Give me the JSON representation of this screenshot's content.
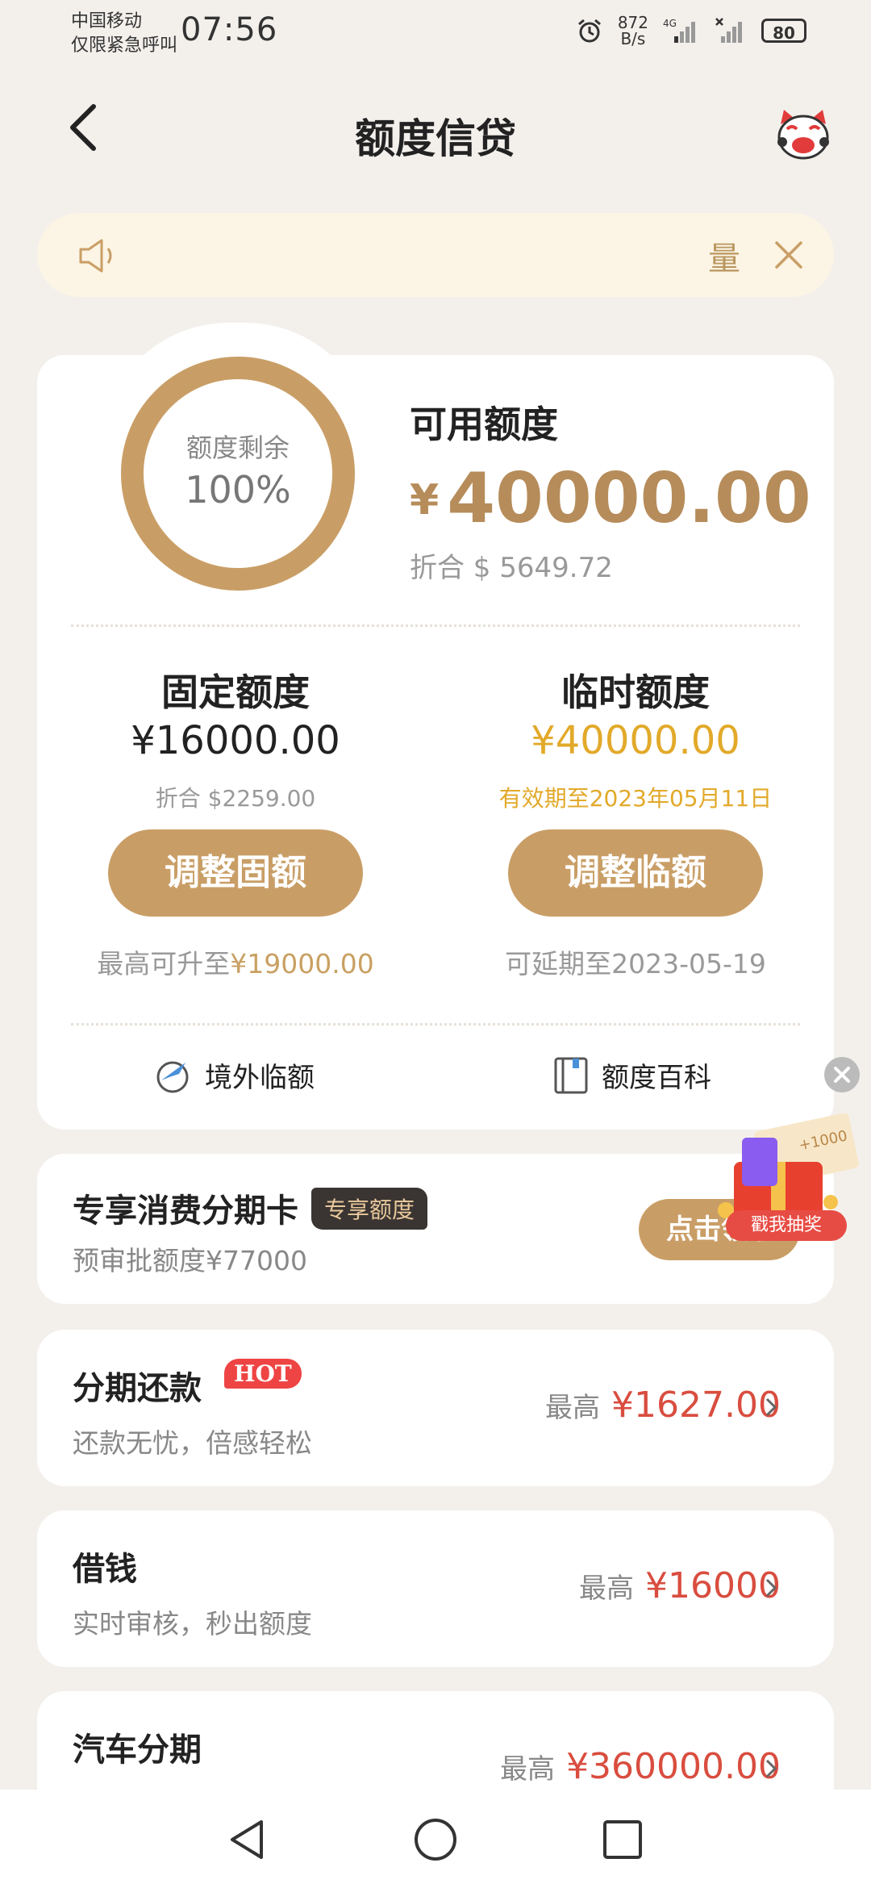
{
  "status_bar": {
    "carrier_line1": "中国移动",
    "carrier_line2": "仅限紧急呼叫",
    "time": "07:56",
    "net_speed_value": "872",
    "net_speed_unit": "B/s",
    "network": "4G",
    "battery": "80"
  },
  "header": {
    "title": "额度信贷"
  },
  "notice": {
    "text": "量"
  },
  "quota": {
    "ring_label": "额度剩余",
    "ring_percent": "100%",
    "ring_fraction": 1.0,
    "available_title": "可用额度",
    "currency_symbol": "¥",
    "available_amount": "40000.00",
    "available_usd": "折合 $ 5649.72"
  },
  "fixed": {
    "title": "固定额度",
    "amount": "¥16000.00",
    "usd": "折合 $2259.00",
    "button": "调整固额",
    "note_prefix": "最高可升至",
    "note_value": "¥19000.00"
  },
  "temp": {
    "title": "临时额度",
    "amount": "¥40000.00",
    "validity": "有效期至2023年05月11日",
    "button": "调整临额",
    "note": "可延期至2023-05-19"
  },
  "links": {
    "overseas": "境外临额",
    "wiki": "额度百科"
  },
  "promo_card": {
    "title": "专享消费分期卡",
    "badge": "专享额度",
    "sub": "预审批额度¥77000",
    "button": "点击领取",
    "float_label": "戳我抽奖",
    "float_amount": "+1000"
  },
  "items": [
    {
      "title": "分期还款",
      "badge": "HOT",
      "sub": "还款无忧，倍感轻松",
      "max_label": "最高",
      "max_value": "¥1627.00"
    },
    {
      "title": "借钱",
      "sub": "实时审核，秒出额度",
      "max_label": "最高",
      "max_value": "¥16000"
    },
    {
      "title": "汽车分期",
      "sub": "",
      "max_label": "最高",
      "max_value": "¥360000.00"
    }
  ],
  "colors": {
    "gold": "#c99e66",
    "red": "#d94d3f",
    "bg": "#f3f0ec"
  }
}
